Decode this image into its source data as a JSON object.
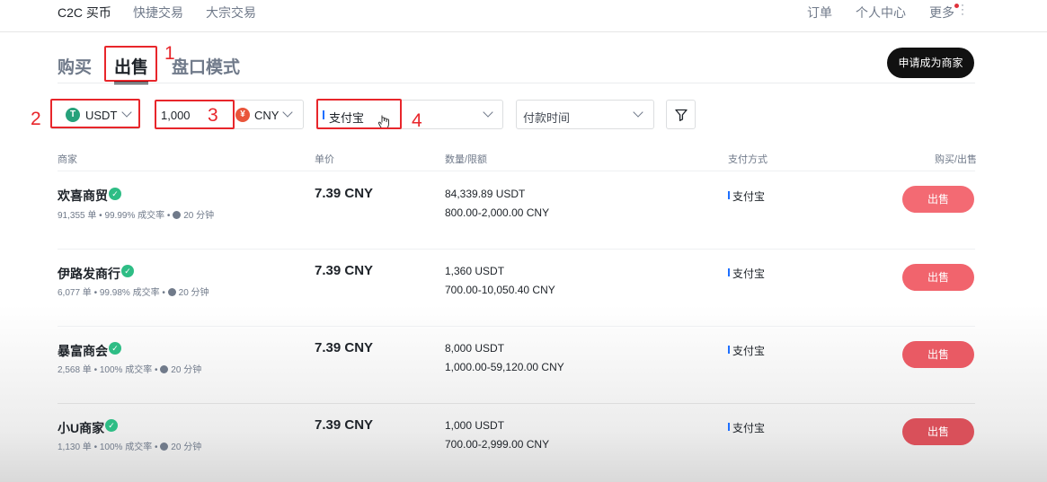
{
  "nav": {
    "left": [
      "C2C 买币",
      "快捷交易",
      "大宗交易"
    ],
    "right": [
      "订单",
      "个人中心",
      "更多"
    ]
  },
  "tabs": [
    "购买",
    "出售",
    "盘口模式"
  ],
  "apply_merchant": "申请成为商家",
  "filters": {
    "coin": "USDT",
    "coin_icon_letter": "T",
    "amount": "1,000",
    "currency": "CNY",
    "currency_icon_letter": "¥",
    "payment": "支付宝",
    "payment_time_placeholder": "付款时间"
  },
  "annotations": [
    "1",
    "2",
    "3",
    "4"
  ],
  "table": {
    "headers": [
      "商家",
      "单价",
      "数量/限额",
      "支付方式",
      "购买/出售"
    ],
    "rows": [
      {
        "name": "欢喜商贸",
        "orders": "91,355 单",
        "rate": "99.99% 成交率",
        "time": "20 分钟",
        "price": "7.39 CNY",
        "qty": "84,339.89 USDT",
        "limit": "800.00-2,000.00 CNY",
        "pay": "支付宝",
        "action": "出售"
      },
      {
        "name": "伊路发商行",
        "orders": "6,077 单",
        "rate": "99.98% 成交率",
        "time": "20 分钟",
        "price": "7.39 CNY",
        "qty": "1,360 USDT",
        "limit": "700.00-10,050.40 CNY",
        "pay": "支付宝",
        "action": "出售"
      },
      {
        "name": "暴富商会",
        "orders": "2,568 单",
        "rate": "100% 成交率",
        "time": "20 分钟",
        "price": "7.39 CNY",
        "qty": "8,000 USDT",
        "limit": "1,000.00-59,120.00 CNY",
        "pay": "支付宝",
        "action": "出售"
      },
      {
        "name": "小U商家",
        "orders": "1,130 单",
        "rate": "100% 成交率",
        "time": "20 分钟",
        "price": "7.39 CNY",
        "qty": "1,000 USDT",
        "limit": "700.00-2,999.00 CNY",
        "pay": "支付宝",
        "action": "出售"
      }
    ]
  },
  "colors": {
    "annotation_red": "#e8262b",
    "sell_button": "#f0616b",
    "verified": "#2ebd85",
    "tether": "#26a17b",
    "cny": "#e9553b"
  }
}
